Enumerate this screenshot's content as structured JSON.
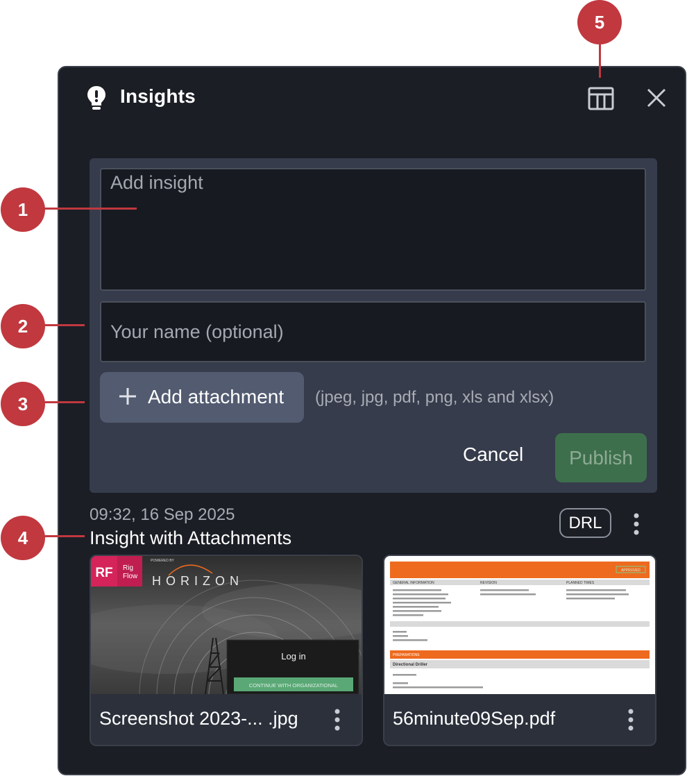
{
  "header": {
    "title": "Insights",
    "icon": "lightbulb-icon",
    "actions": [
      "table-layout-icon",
      "close-icon"
    ]
  },
  "form": {
    "insight_placeholder": "Add insight",
    "name_placeholder": "Your name (optional)",
    "attach_label": "Add attachment",
    "attach_hint": "(jpeg, jpg, pdf, png, xls and xlsx)",
    "cancel_label": "Cancel",
    "publish_label": "Publish"
  },
  "insight": {
    "timestamp": "09:32, 16 Sep 2025",
    "title": "Insight with Attachments",
    "badge": "DRL",
    "attachments": [
      {
        "name": "Screenshot 2023-... .jpg",
        "preview": {
          "logo": "RF",
          "logo_sub1": "Rig",
          "logo_sub2": "Flow",
          "powered": "POWERED BY",
          "brand": "HORIZON",
          "login": "Log in",
          "continue": "CONTINUE WITH ORGANIZATIONAL"
        }
      },
      {
        "name": "56minute09Sep.pdf",
        "preview": {
          "status": "APPROVED",
          "s1": "GENERAL INFORMATION",
          "s2": "REVISION",
          "s3": "PLANNED TIMES",
          "s4": "PREPARATIONS",
          "s5": "Directional Driller"
        }
      }
    ]
  },
  "callouts": [
    "1",
    "2",
    "3",
    "4",
    "5"
  ],
  "colors": {
    "panel": "#1b1e25",
    "form": "#363c4b",
    "publish": "#3e6f4c",
    "accent_orange": "#ee6a1f",
    "callout": "#c1383f"
  }
}
